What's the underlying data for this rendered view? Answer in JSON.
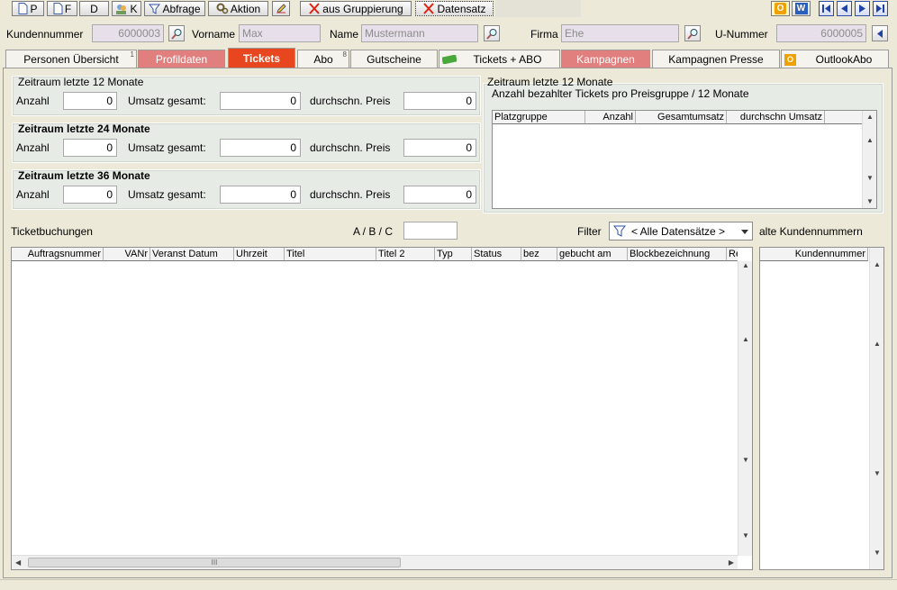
{
  "toolbar": {
    "btn_p": "P",
    "btn_f": "F",
    "btn_d": "D",
    "btn_k": "K",
    "btn_abfrage": "Abfrage",
    "btn_aktion": "Aktion",
    "btn_aus_gruppierung": "aus Gruppierung",
    "btn_datensatz": "Datensatz",
    "btn_o": "O",
    "btn_w": "W"
  },
  "header": {
    "kundennummer_label": "Kundennummer",
    "kundennummer_value": "6000003",
    "vorname_label": "Vorname",
    "vorname_value": "Max",
    "name_label": "Name",
    "name_value": "Mustermann",
    "firma_label": "Firma",
    "firma_value": "Ehe",
    "unummer_label": "U-Nummer",
    "unummer_value": "6000005"
  },
  "tabs": [
    {
      "label": "Personen Übersicht",
      "badge": "1"
    },
    {
      "label": "Profildaten",
      "badge": ""
    },
    {
      "label": "Tickets",
      "badge": ""
    },
    {
      "label": "Abo",
      "badge": "8"
    },
    {
      "label": "Gutscheine",
      "badge": ""
    },
    {
      "label": "Tickets + ABO",
      "badge": ""
    },
    {
      "label": "Kampagnen",
      "badge": ""
    },
    {
      "label": "Kampagnen Presse",
      "badge": ""
    },
    {
      "label": "OutlookAbo",
      "badge": ""
    }
  ],
  "periods": [
    {
      "title": "Zeitraum letzte 12 Monate",
      "anzahl_label": "Anzahl",
      "anzahl": "0",
      "umsatz_label": "Umsatz gesamt:",
      "umsatz": "0",
      "preis_label": "durchschn. Preis",
      "preis": "0"
    },
    {
      "title": "Zeitraum letzte 24 Monate",
      "anzahl_label": "Anzahl",
      "anzahl": "0",
      "umsatz_label": "Umsatz gesamt:",
      "umsatz": "0",
      "preis_label": "durchschn. Preis",
      "preis": "0"
    },
    {
      "title": "Zeitraum letzte 36 Monate",
      "anzahl_label": "Anzahl",
      "anzahl": "0",
      "umsatz_label": "Umsatz gesamt:",
      "umsatz": "0",
      "preis_label": "durchschn. Preis",
      "preis": "0"
    }
  ],
  "preisgruppe": {
    "title": "Zeitraum letzte 12 Monate",
    "subtitle": "Anzahl bezahlter Tickets pro Preisgruppe / 12 Monate",
    "columns": [
      "Platzgruppe",
      "Anzahl",
      "Gesamtumsatz",
      "durchschn Umsatz"
    ]
  },
  "bookings": {
    "title": "Ticketbuchungen",
    "abc_label": "A / B / C",
    "abc_value": "",
    "filter_label": "Filter",
    "filter_value": "< Alle Datensätze >",
    "columns": [
      "Auftragsnummer",
      "VANr",
      "Veranst Datum",
      "Uhrzeit",
      "Titel",
      "Titel 2",
      "Typ",
      "Status",
      "bez",
      "gebucht am",
      "Blockbezeichnung",
      "Re"
    ],
    "scroll_grip": "III"
  },
  "old_numbers": {
    "title": "alte Kundennummern",
    "columns": [
      "Kundennummer"
    ]
  },
  "colors": {
    "bg": "#ece9d8",
    "group_bg": "#e6ebe6",
    "active_tab": "#e8461e",
    "red_tab": "#e17f7f",
    "readonly_field": "#e7dfe9"
  }
}
